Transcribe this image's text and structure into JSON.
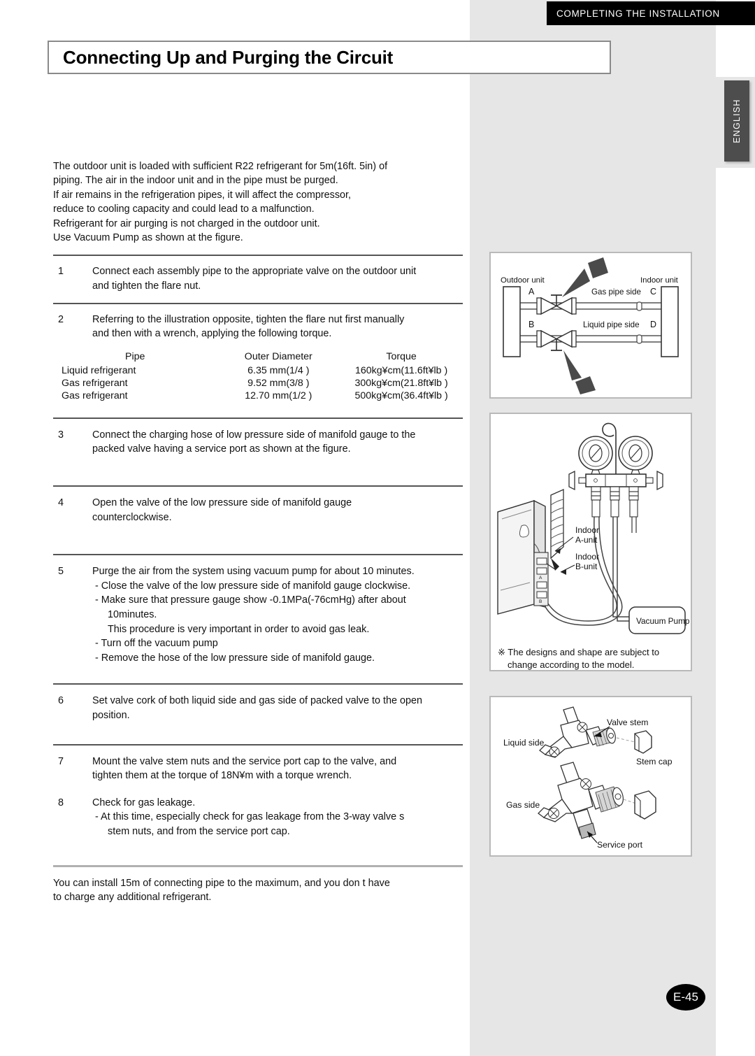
{
  "header": {
    "band_label": "COMPLETING THE INSTALLATION",
    "language_tab": "ENGLISH"
  },
  "title": "Connecting Up and Purging the Circuit",
  "intro": [
    "The outdoor unit is loaded with sufficient R22 refrigerant for 5m(16ft. 5in) of",
    "piping. The air in the indoor unit and in the pipe must be purged.",
    "If air remains in the refrigeration pipes, it will affect the compressor,",
    "reduce to cooling capacity and could lead to a malfunction.",
    "Refrigerant for air purging is not charged in the outdoor unit.",
    "Use Vacuum Pump as shown at the figure."
  ],
  "steps": [
    {
      "num": "1",
      "lines": [
        "Connect each assembly pipe to the appropriate valve on the outdoor unit",
        "and tighten the flare nut."
      ]
    },
    {
      "num": "2",
      "lines": [
        "Referring to the illustration opposite, tighten the flare nut  first manually",
        "and then with a wrench, applying the following torque."
      ]
    },
    {
      "num": "3",
      "lines": [
        "Connect the charging hose of low pressure side of manifold gauge to the",
        "packed valve having a service port as shown at the figure."
      ]
    },
    {
      "num": "4",
      "lines": [
        "Open the valve of the low pressure side of manifold gauge",
        "counterclockwise."
      ]
    },
    {
      "num": "5",
      "lines": [
        "Purge the air from the system using vacuum pump for about 10 minutes."
      ],
      "sublines": [
        "- Close the valve of the low pressure side of manifold gauge clockwise.",
        "- Make sure that pressure gauge show -0.1MPa(-76cmHg) after about"
      ],
      "contlines": [
        "10minutes.",
        "This procedure is very important in order to avoid gas leak."
      ],
      "sublines2": [
        "- Turn off the vacuum pump",
        "- Remove the hose of the low pressure side of manifold gauge."
      ]
    },
    {
      "num": "6",
      "lines": [
        "Set valve cork of both liquid side and gas side of packed valve to the open",
        "position."
      ]
    },
    {
      "num": "7",
      "lines": [
        "Mount the valve stem nuts and the service port cap to the valve, and",
        "tighten them at the torque of 18N¥m with a torque wrench."
      ]
    },
    {
      "num": "8",
      "lines": [
        "Check for gas leakage."
      ],
      "sublines": [
        "- At this time, especially check for gas leakage from the 3-way valve s"
      ],
      "contlines": [
        "stem nuts, and from the service port cap."
      ]
    }
  ],
  "torque_table": {
    "headers": [
      "Pipe",
      "Outer Diameter",
      "Torque"
    ],
    "rows": [
      [
        "Liquid refrigerant",
        "6.35 mm(1/4 )",
        "160kg¥cm(11.6ft¥lb )"
      ],
      [
        "Gas refrigerant",
        "9.52 mm(3/8 )",
        "300kg¥cm(21.8ft¥lb )"
      ],
      [
        "Gas refrigerant",
        "12.70 mm(1/2 )",
        "500kg¥cm(36.4ft¥lb )"
      ]
    ]
  },
  "closing": [
    "You can install 15m of connecting pipe to the maximum, and you don t have",
    "to charge any additional refrigerant."
  ],
  "figures": {
    "piping": {
      "outdoor_unit": "Outdoor unit",
      "indoor_unit": "Indoor unit",
      "label_a": "A",
      "label_b": "B",
      "label_c": "C",
      "label_d": "D",
      "gas_pipe_side": "Gas pipe side",
      "liquid_pipe_side": "Liquid pipe side"
    },
    "gauge": {
      "indoor_a_line1": "Indoor",
      "indoor_a_line2": "A-unit",
      "indoor_b_line1": "Indoor",
      "indoor_b_line2": "B-unit",
      "vacuum_pump": "Vacuum Pump",
      "note_line1": "※ The designs and shape are subject to",
      "note_line2": "change according to the model."
    },
    "valve": {
      "liquid_side": "Liquid side",
      "gas_side": "Gas side",
      "valve_stem": "Valve stem",
      "stem_cap": "Stem cap",
      "service_port": "Service port"
    }
  },
  "page_number": {
    "prefix": "E",
    "value": "-45",
    "full": "E-45"
  },
  "colors": {
    "panel_grey": "#e6e6e6",
    "header_black": "#000000",
    "tab_grey": "#4d4d4d",
    "fig_border": "#b9b9b9",
    "rule": "#555555"
  }
}
